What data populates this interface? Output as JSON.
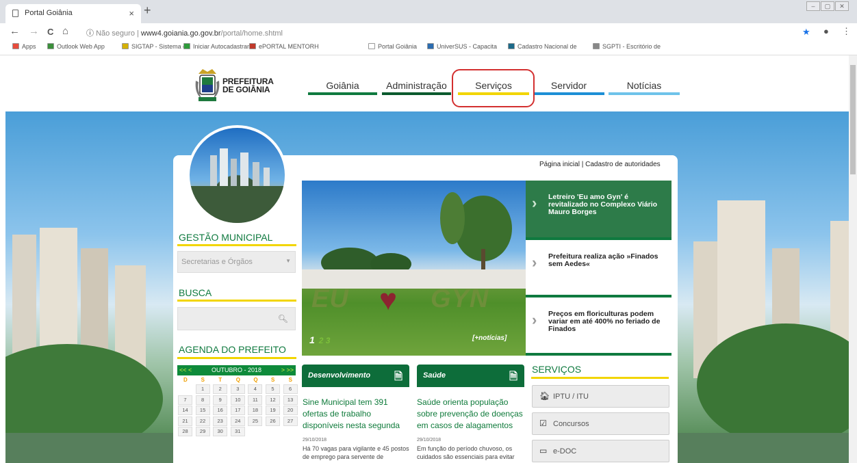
{
  "browser": {
    "tab_title": "Portal Goiânia",
    "tab_close": "×",
    "new_tab": "+",
    "back": "←",
    "forward": "→",
    "reload": "C",
    "home": "⌂",
    "info": "ⓘ",
    "security_label": "Não seguro",
    "url_host": "www4.goiania.go.gov.br",
    "url_path": "/portal/home.shtml",
    "star": "★",
    "profile": "●",
    "menu": "⋮",
    "win_min": "–",
    "win_max": "▢",
    "win_close": "✕"
  },
  "bookmarks": [
    {
      "label": "Apps",
      "color": "#e74c3c"
    },
    {
      "label": "Outlook Web App",
      "color": "#3b8f3b"
    },
    {
      "label": "SIGTAP - Sistema de",
      "color": "#d4b106"
    },
    {
      "label": "Iniciar Autocadastran",
      "color": "#2e9b3b"
    },
    {
      "label": "ePORTAL MENTORH",
      "color": "#c0392b"
    },
    {
      "label": "Portal Goiânia",
      "color": "#ffffff"
    },
    {
      "label": "UniverSUS - Capacita",
      "color": "#2b6cb0"
    },
    {
      "label": "Cadastro Nacional de",
      "color": "#1c6a8a"
    },
    {
      "label": "SGPTI - Escritório de",
      "color": "#888888"
    }
  ],
  "site": {
    "logo_line1": "PREFEITURA",
    "logo_line2": "DE GOIÂNIA",
    "nav": [
      {
        "label": "Goiânia",
        "color": "#0f7a3f"
      },
      {
        "label": "Administração",
        "color": "#0b5a2e"
      },
      {
        "label": "Serviços",
        "color": "#f2d500"
      },
      {
        "label": "Servidor",
        "color": "#1d8fd6"
      },
      {
        "label": "Notícias",
        "color": "#6ec3ea"
      }
    ],
    "highlight_color": "#d32f2f"
  },
  "top_links": {
    "home": "Página inicial",
    "separator": "|",
    "authorities": "Cadastro de autoridades"
  },
  "sidebar": {
    "gestao_title": "GESTÃO MUNICIPAL",
    "select_placeholder": "Secretarias e Órgãos",
    "busca_title": "BUSCA",
    "agenda_title": "AGENDA DO PREFEITO",
    "calendar": {
      "prev": "<< <",
      "month": "OUTUBRO - 2018",
      "next": "> >>",
      "weekdays": [
        "D",
        "S",
        "T",
        "Q",
        "Q",
        "S",
        "S"
      ],
      "weeks": [
        [
          "",
          "1",
          "2",
          "3",
          "4",
          "5",
          "6"
        ],
        [
          "7",
          "8",
          "9",
          "10",
          "11",
          "12",
          "13"
        ],
        [
          "14",
          "15",
          "16",
          "17",
          "18",
          "19",
          "20"
        ],
        [
          "21",
          "22",
          "23",
          "24",
          "25",
          "26",
          "27"
        ],
        [
          "28",
          "29",
          "30",
          "31",
          "",
          "",
          ""
        ]
      ]
    }
  },
  "slider": {
    "image_text_left": "EU",
    "image_text_right": "GYN",
    "current_page": "1",
    "other_pages": "2 3",
    "more_link": "[+notícias]"
  },
  "news": [
    {
      "title": "Letreiro 'Eu amo Gyn' é revitalizado no Complexo Viário Mauro Borges",
      "active": true
    },
    {
      "title": "Prefeitura realiza ação »Finados sem Aedes«",
      "active": false
    },
    {
      "title": "Preços em floriculturas podem variar em até 400% no feriado de Finados",
      "active": false
    }
  ],
  "articles": [
    {
      "category": "Desenvolvimento",
      "title": "Sine Municipal tem 391 ofertas de trabalho disponíveis nesta segunda",
      "date": "29/10/2018",
      "text": "Há 70 vagas para vigilante e 45 postos de emprego para servente de"
    },
    {
      "category": "Saúde",
      "title": "Saúde orienta população sobre prevenção de doenças em casos de alagamentos",
      "date": "29/10/2018",
      "text": "Em função do período chuvoso, os cuidados são essenciais para evitar"
    }
  ],
  "services": {
    "title": "SERVIÇOS",
    "items": [
      {
        "label": "IPTU / ITU",
        "icon": "home-icon"
      },
      {
        "label": "Concursos",
        "icon": "checkbox-icon"
      },
      {
        "label": "e-DOC",
        "icon": "inbox-icon"
      }
    ]
  }
}
